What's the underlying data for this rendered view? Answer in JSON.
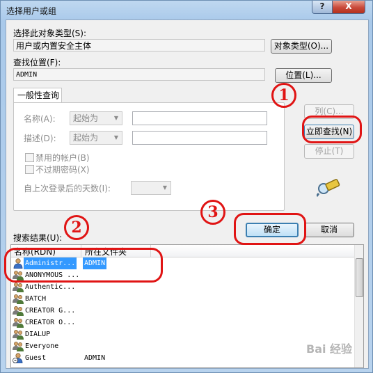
{
  "window": {
    "title": "选择用户或组",
    "help_button": "?",
    "close_button": "X"
  },
  "object_type": {
    "label": "选择此对象类型(S):",
    "value": "用户或内置安全主体",
    "button": "对象类型(O)..."
  },
  "location": {
    "label": "查找位置(F):",
    "value": "ADMIN",
    "button": "位置(L)..."
  },
  "query": {
    "tab_label": "一般性查询",
    "name_label": "名称(A):",
    "name_mode": "起始为",
    "desc_label": "描述(D):",
    "desc_mode": "起始为",
    "disabled_accounts": "禁用的帐户(B)",
    "no_expire_pwd": "不过期密码(X)",
    "days_since_login": "自上次登录后的天数(I):"
  },
  "side_buttons": {
    "columns": "列(C)...",
    "find_now": "立即查找(N)",
    "stop": "停止(T)"
  },
  "results": {
    "label": "搜索结果(U):",
    "columns": [
      "名称(RDN)",
      "所在文件夹"
    ],
    "rows": [
      {
        "name": "Administr...",
        "folder": "ADMIN",
        "selected": true,
        "icon": "user-icon"
      },
      {
        "name": "ANONYMOUS ...",
        "folder": "",
        "selected": false,
        "icon": "group-icon"
      },
      {
        "name": "Authentic...",
        "folder": "",
        "selected": false,
        "icon": "group-icon"
      },
      {
        "name": "BATCH",
        "folder": "",
        "selected": false,
        "icon": "group-icon"
      },
      {
        "name": "CREATOR G...",
        "folder": "",
        "selected": false,
        "icon": "group-icon"
      },
      {
        "name": "CREATOR O...",
        "folder": "",
        "selected": false,
        "icon": "group-icon"
      },
      {
        "name": "DIALUP",
        "folder": "",
        "selected": false,
        "icon": "group-icon"
      },
      {
        "name": "Everyone",
        "folder": "",
        "selected": false,
        "icon": "group-icon"
      },
      {
        "name": "Guest",
        "folder": "ADMIN",
        "selected": false,
        "icon": "user-disabled-icon"
      }
    ]
  },
  "dialog_buttons": {
    "ok": "确定",
    "cancel": "取消"
  },
  "annotations": {
    "n1": "1",
    "n2": "2",
    "n3": "3",
    "color": "#e01414"
  },
  "watermark": "Bai 经验"
}
